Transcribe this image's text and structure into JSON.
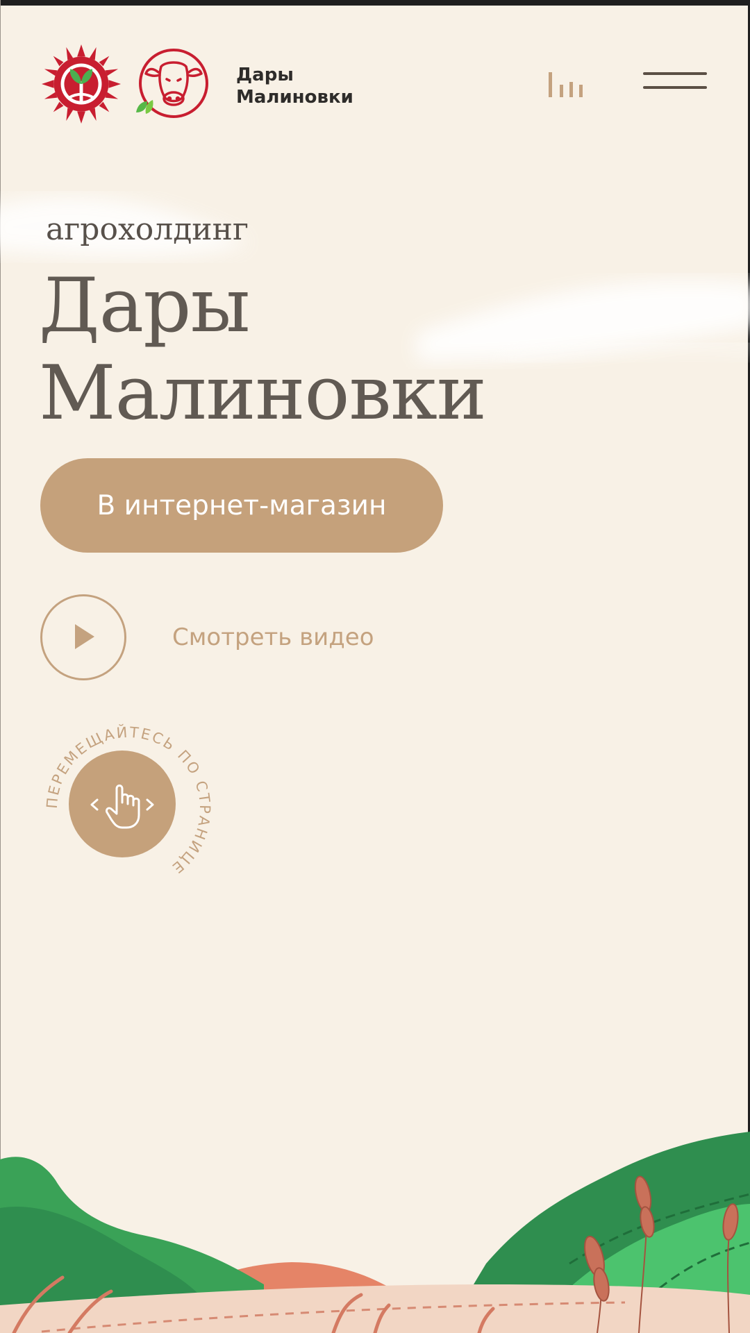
{
  "header": {
    "brand_line1": "Дары",
    "brand_line2": "Малиновки",
    "logo_sun_icon": "sun-sprout-logo-icon",
    "logo_cow_icon": "cow-head-logo-icon",
    "accessibility_icon": "bars-icon",
    "menu_icon": "hamburger-menu-icon"
  },
  "hero": {
    "kicker": "агрохолдинг",
    "title_line1": "Дары",
    "title_line2": "Малиновки",
    "shop_button_label": "В интернет-магазин",
    "video_label": "Смотреть видео",
    "play_icon": "play-icon"
  },
  "nav_hint": {
    "text": "ПЕРЕМЕЩАЙТЕСЬ ПО СТРАНИЦЕ",
    "icon": "hand-swipe-icon"
  },
  "colors": {
    "background": "#f8f1e6",
    "accent": "#c5a17b",
    "logo_red": "#c81e30",
    "text_dark": "#2e2c2a",
    "title_gray": "#615a53"
  }
}
